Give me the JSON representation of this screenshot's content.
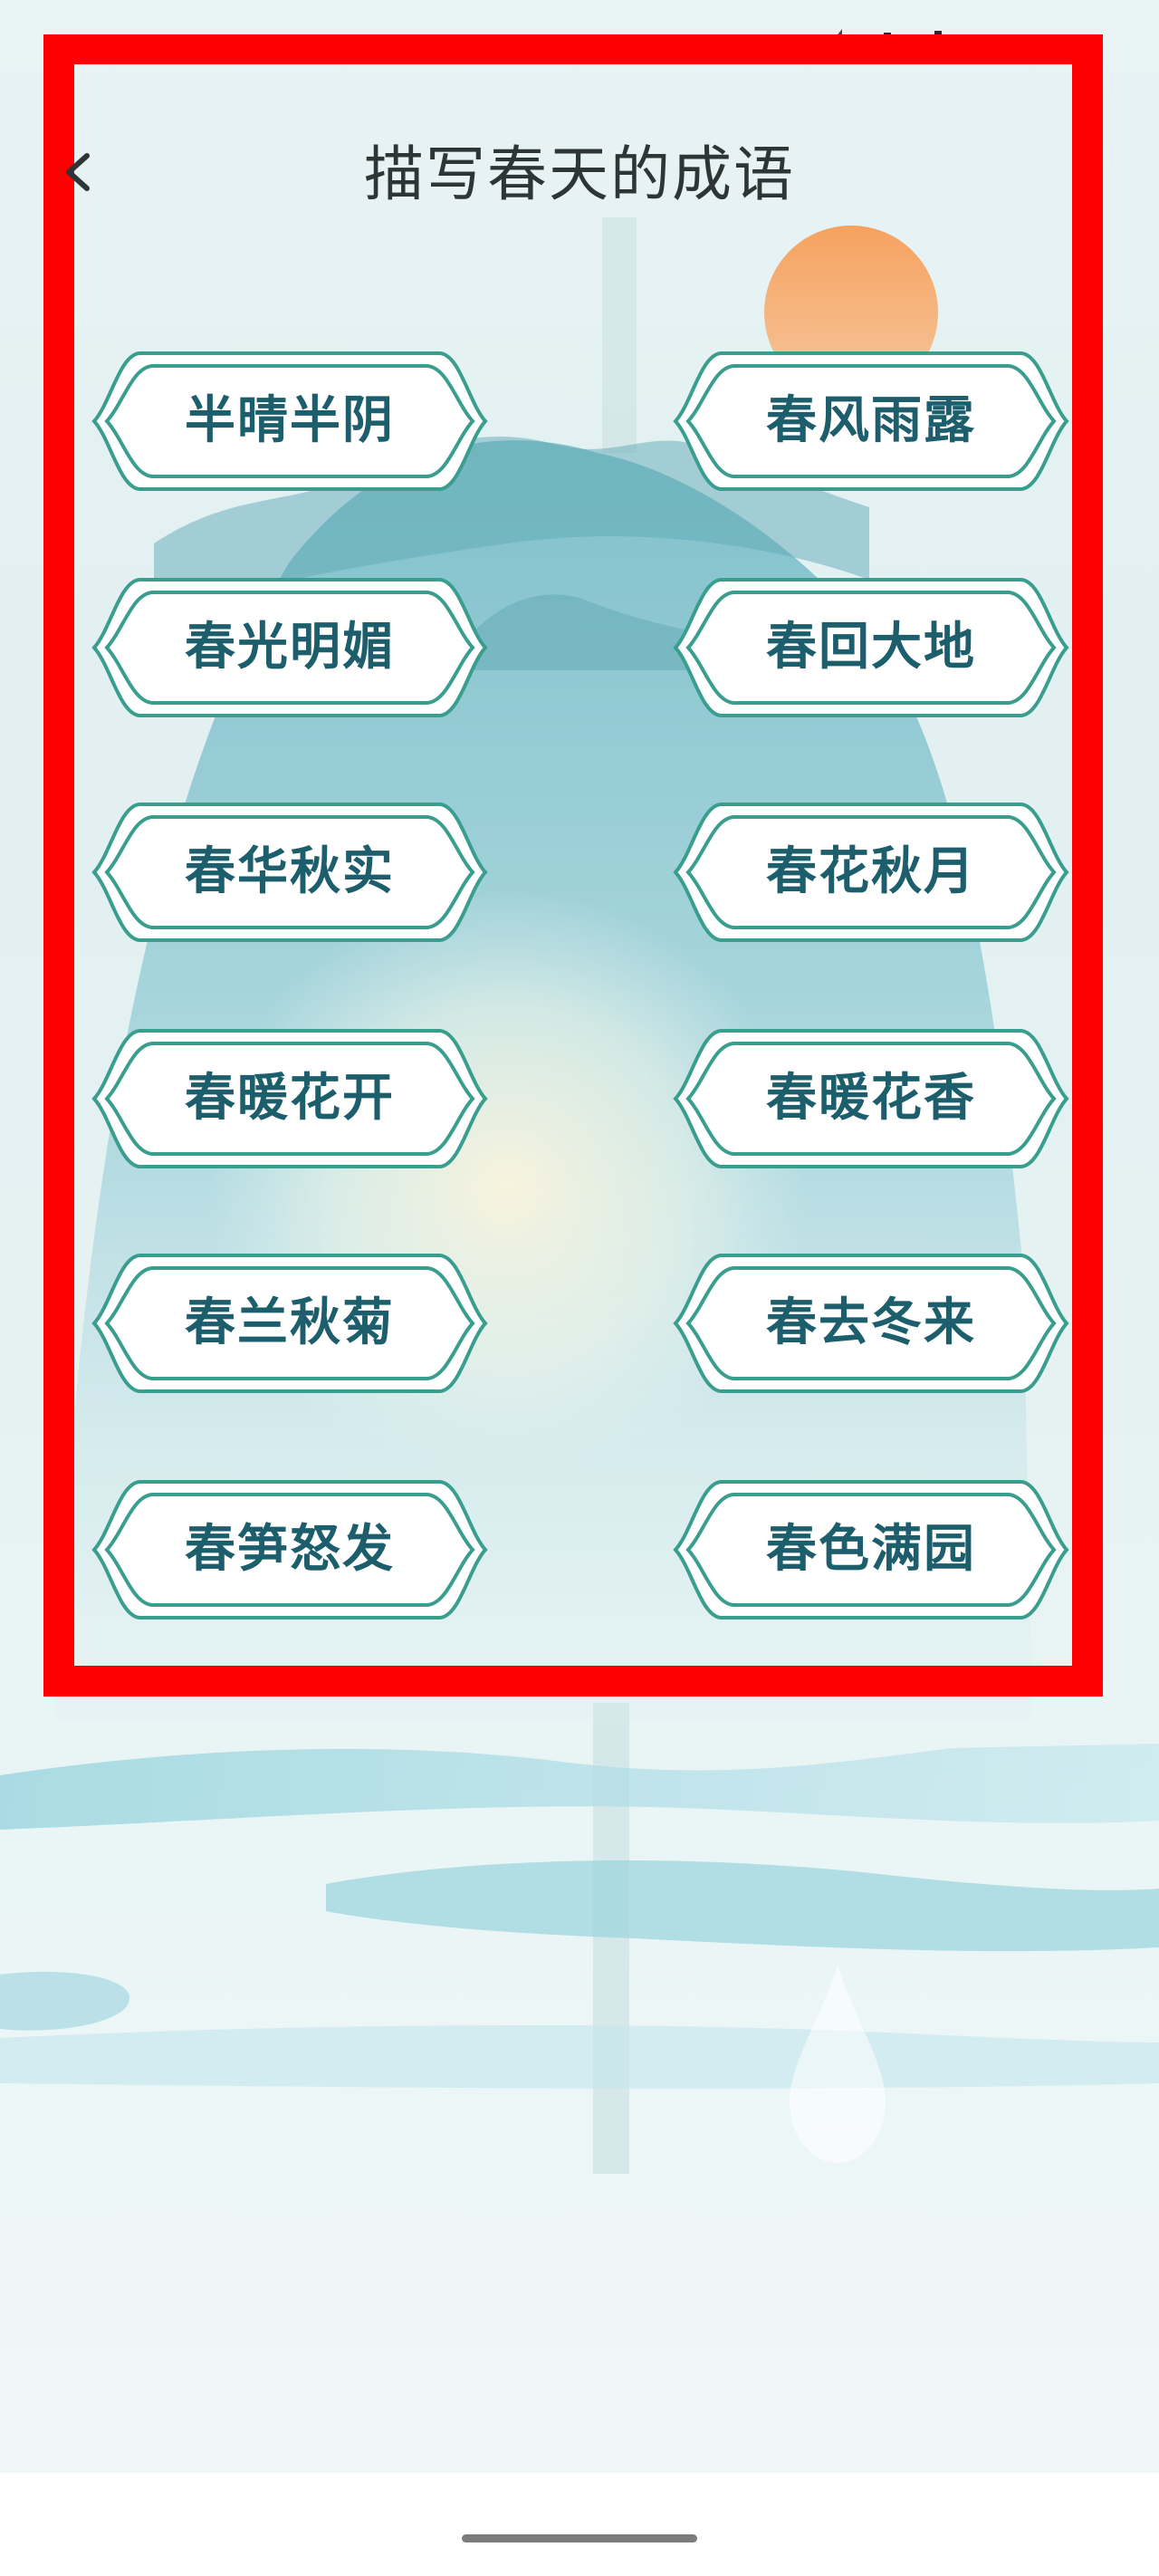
{
  "header": {
    "title": "描写春天的成语",
    "back_icon": "chevron-left-icon"
  },
  "colors": {
    "highlight_frame": "#ff0000",
    "button_border": "#3a9e8e",
    "button_text": "#1d5e6d",
    "sun": "#f3a56a",
    "mountain": "#7cc1cc"
  },
  "idioms": [
    "半晴半阴",
    "春风雨露",
    "春光明媚",
    "春回大地",
    "春华秋实",
    "春花秋月",
    "春暖花开",
    "春暖花香",
    "春兰秋菊",
    "春去冬来",
    "春笋怒发",
    "春色满园"
  ]
}
